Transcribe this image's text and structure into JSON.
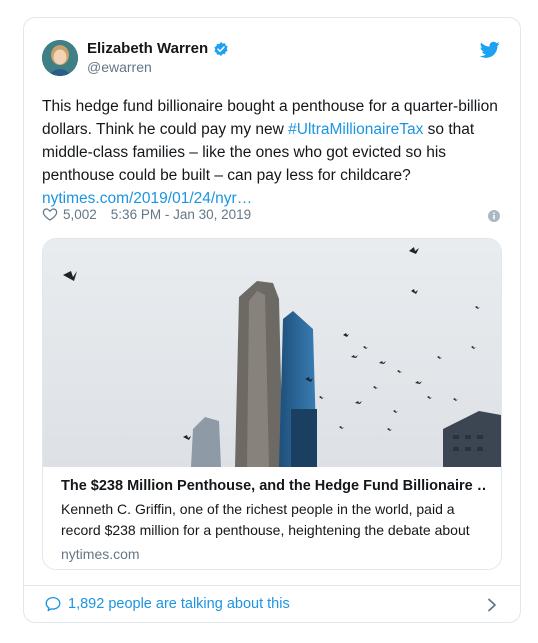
{
  "author": {
    "name": "Elizabeth Warren",
    "handle": "@ewarren"
  },
  "tweet": {
    "text_part1": "This hedge fund billionaire bought a penthouse for a quarter-billion dollars. Think he could pay my new ",
    "hashtag": "#UltraMillionaireTax",
    "text_part2": " so that middle-class families – like the ones who got evicted so his penthouse could be built – can pay less for childcare?",
    "link": "nytimes.com/2019/01/24/nyr…"
  },
  "meta": {
    "likes": "5,002",
    "timestamp": "5:36 PM - Jan 30, 2019"
  },
  "media": {
    "title": "The $238 Million Penthouse, and the Hedge Fund Billionaire …",
    "description": "Kenneth C. Griffin, one of the richest people in the world, paid a record $238 million for a penthouse, heightening the debate about",
    "domain": "nytimes.com"
  },
  "footer": {
    "talking": "1,892 people are talking about this"
  },
  "colors": {
    "accent": "#1b95e0",
    "muted": "#657786",
    "border": "#e1e8ed"
  },
  "icons": [
    "verified-badge-icon",
    "twitter-bird-icon",
    "heart-icon",
    "info-icon",
    "speech-bubble-icon",
    "chevron-right-icon"
  ]
}
